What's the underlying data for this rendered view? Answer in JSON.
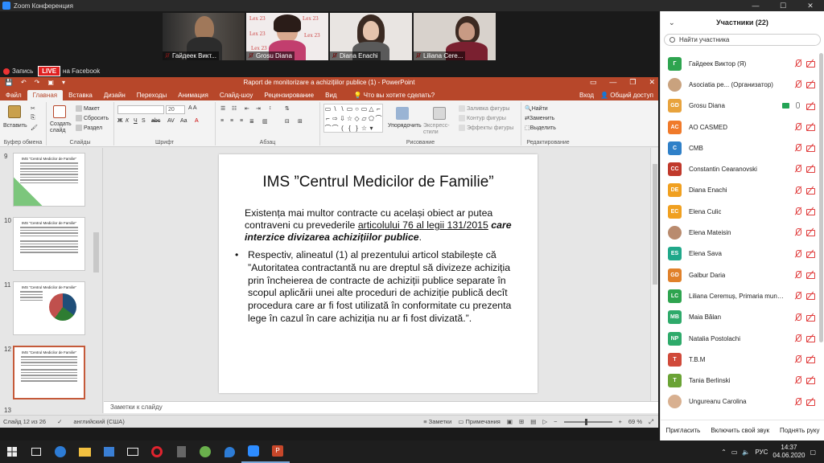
{
  "zoom": {
    "window_title": "Zoom Конференция",
    "recording_label": "Запись",
    "live_label": "LIVE",
    "live_target": "на Facebook",
    "videos": [
      {
        "name": "Гайдеек Викт..."
      },
      {
        "name": "Grosu Diana"
      },
      {
        "name": "Diana Enachi"
      },
      {
        "name": "Liliana Cere..."
      }
    ],
    "lex_text": "Lex 23"
  },
  "ppt": {
    "title": "Raport de monitorizare a achizițiilor publice (1) - PowerPoint",
    "tabs": [
      "Файл",
      "Главная",
      "Вставка",
      "Дизайн",
      "Переходы",
      "Анимация",
      "Слайд-шоу",
      "Рецензирование",
      "Вид"
    ],
    "active_tab": "Главная",
    "tell_me": "Что вы хотите сделать?",
    "signin": "Вход",
    "share": "Общий доступ",
    "ribbon": {
      "paste": "Вставить",
      "new_slide": "Создать слайд",
      "layout": "Макет",
      "reset": "Сбросить",
      "section": "Раздел",
      "font_size": "20",
      "arrange": "Упорядочить",
      "quick_styles": "Экспресс-стили",
      "shape_fill": "Заливка фигуры",
      "shape_outline": "Контур фигуры",
      "shape_effects": "Эффекты фигуры",
      "find": "Найти",
      "replace": "Заменить",
      "select": "Выделить",
      "groups": {
        "clipboard": "Буфер обмена",
        "slides": "Слайды",
        "font": "Шрифт",
        "paragraph": "Абзац",
        "drawing": "Рисование",
        "editing": "Редактирование"
      }
    },
    "thumbnails": [
      {
        "num": "9",
        "title": "IMS ”Centrul Medicilor de Familie”"
      },
      {
        "num": "10",
        "title": "IMS ”Centrul Medicilor de Familie”"
      },
      {
        "num": "11",
        "title": "IMS ”Centrul Medicilor de Familie”"
      },
      {
        "num": "12",
        "title": "IMS ”Centrul Medicilor de Familie”"
      },
      {
        "num": "13",
        "title": ""
      }
    ],
    "slide": {
      "title": "IMS ”Centrul Medicilor de Familie”",
      "p1_a": "Existența mai multor contracte cu același obiect ar putea contraveni cu prevederile ",
      "p1_link": "articolului 76 al legii 131/2015",
      "p1_b": " care interzice divizarea achizițiilor publice",
      "p1_end": ".",
      "p2": "Respectiv, alineatul (1) al prezentului articol stabilește că ”Autoritatea contractantă nu are dreptul să divizeze achiziția prin încheierea de contracte de achiziții publice separate în scopul aplicării unei alte proceduri de achiziție publică decît procedura care ar fi fost utilizată în conformitate cu prezenta lege în cazul în care achiziția nu ar fi fost divizată.”."
    },
    "notes_placeholder": "Заметки к слайду",
    "status": {
      "slide_count": "Слайд 12 из 26",
      "language": "английский (США)",
      "notes_btn": "Заметки",
      "comments_btn": "Примечания",
      "zoom": "69 %"
    }
  },
  "participants": {
    "header": "Участники (22)",
    "search_placeholder": "Найти участника",
    "list": [
      {
        "initials": "Г",
        "name": "Гайдеек Виктор (Я)",
        "color": "#2ea44f",
        "photo": false
      },
      {
        "initials": "",
        "name": "Asociatia pe... (Организатор)",
        "color": "#c9a27e",
        "photo": true
      },
      {
        "initials": "GD",
        "name": "Grosu Diana",
        "color": "#e8a33d",
        "photo": false,
        "sharing": true
      },
      {
        "initials": "AC",
        "name": "AO CASMED",
        "color": "#f07a2a",
        "photo": false
      },
      {
        "initials": "C",
        "name": "CMB",
        "color": "#2f80c8",
        "photo": false
      },
      {
        "initials": "CC",
        "name": "Constantin Cearanovski",
        "color": "#c0392b",
        "photo": false
      },
      {
        "initials": "DE",
        "name": "Diana Enachi",
        "color": "#f0a020",
        "photo": false
      },
      {
        "initials": "EC",
        "name": "Elena Culic",
        "color": "#f0a020",
        "photo": false
      },
      {
        "initials": "",
        "name": "Elena Mateisin",
        "color": "#b98b6e",
        "photo": true
      },
      {
        "initials": "ES",
        "name": "Elena Sava",
        "color": "#20a88a",
        "photo": false
      },
      {
        "initials": "GD",
        "name": "Galbur Daria",
        "color": "#e0812a",
        "photo": false
      },
      {
        "initials": "LC",
        "name": "Liliana Ceremuș, Primaria mun.B...",
        "color": "#2ea44f",
        "photo": false
      },
      {
        "initials": "MB",
        "name": "Maia Bălan",
        "color": "#2eaa6a",
        "photo": false
      },
      {
        "initials": "NP",
        "name": "Natalia Postolachi",
        "color": "#2eaa6a",
        "photo": false
      },
      {
        "initials": "T",
        "name": "T.B.M",
        "color": "#d04a3a",
        "photo": false
      },
      {
        "initials": "T",
        "name": "Tania Berlinski",
        "color": "#6aa335",
        "photo": false
      },
      {
        "initials": "",
        "name": "Ungureanu Carolina",
        "color": "#d8b090",
        "photo": true
      }
    ],
    "footer": {
      "invite": "Пригласить",
      "unmute": "Включить свой звук",
      "raise_hand": "Поднять руку"
    }
  },
  "taskbar": {
    "lang": "РУС",
    "time": "14:37",
    "date": "04.06.2020"
  }
}
